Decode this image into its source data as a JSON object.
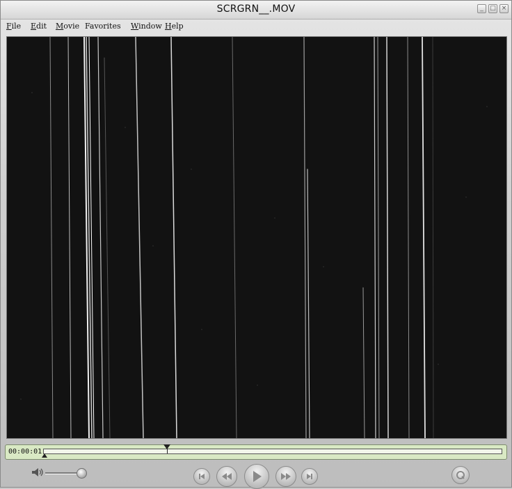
{
  "window": {
    "title": "SCRGRN__.MOV",
    "controls": {
      "minimize": "_",
      "maximize": "□",
      "close": "×"
    }
  },
  "menu": {
    "items": [
      {
        "key": "F",
        "rest": "ile"
      },
      {
        "key": "E",
        "rest": "dit"
      },
      {
        "key": "M",
        "rest": "ovie"
      },
      {
        "key": "",
        "rest": "Favorites"
      },
      {
        "key": "W",
        "rest": "indow"
      },
      {
        "key": "H",
        "rest": "elp"
      }
    ]
  },
  "player": {
    "timecode": "00:00:01",
    "playhead_fraction": 0.27,
    "volume_fraction": 0.92
  },
  "icons": {
    "speaker": "speaker-icon",
    "skip_start": "skip-to-start-icon",
    "rewind": "rewind-icon",
    "play": "play-icon",
    "fast_forward": "fast-forward-icon",
    "skip_end": "skip-to-end-icon",
    "quicktime": "quicktime-logo-icon"
  },
  "colors": {
    "video_bg": "#111111",
    "timebar_bg": "#d9e9c4"
  }
}
